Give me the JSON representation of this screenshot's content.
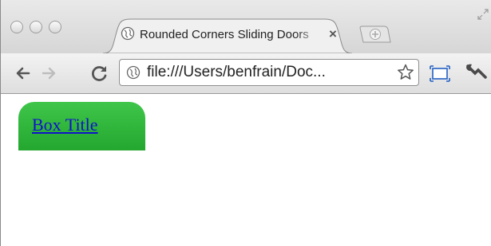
{
  "window": {
    "buttons": [
      {
        "name": "close-window-button"
      },
      {
        "name": "minimize-window-button"
      },
      {
        "name": "zoom-window-button"
      }
    ]
  },
  "tab": {
    "title": "Rounded Corners Sliding Doors",
    "favicon": "globe-icon",
    "close_glyph": "×"
  },
  "new_tab": {
    "icon": "new-tab-icon"
  },
  "toolbar": {
    "back_icon": "back-arrow-icon",
    "forward_icon": "forward-arrow-icon",
    "reload_icon": "reload-icon",
    "address": "file:///Users/benfrain/Doc...",
    "bookmark_icon": "star-icon",
    "page_icon": "page-menu-icon",
    "wrench_icon": "wrench-icon"
  },
  "page": {
    "box_title": "Box Title",
    "box_color": "#2fb83a",
    "link_color": "#1111cc"
  }
}
